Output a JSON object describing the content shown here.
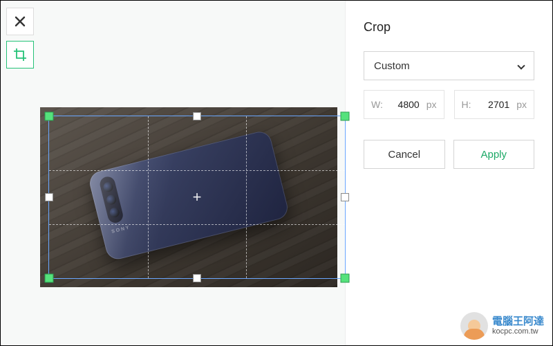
{
  "toolbar": {
    "close_icon": "close-icon",
    "crop_icon": "crop-icon"
  },
  "panel": {
    "title": "Crop",
    "preset_label": "Custom",
    "width_label": "W:",
    "width_value": "4800",
    "width_unit": "px",
    "height_label": "H:",
    "height_value": "2701",
    "height_unit": "px",
    "cancel_label": "Cancel",
    "apply_label": "Apply"
  },
  "photo": {
    "brand": "SONY"
  },
  "watermark": {
    "line1": "電腦王阿達",
    "line2": "kocpc.com.tw"
  }
}
